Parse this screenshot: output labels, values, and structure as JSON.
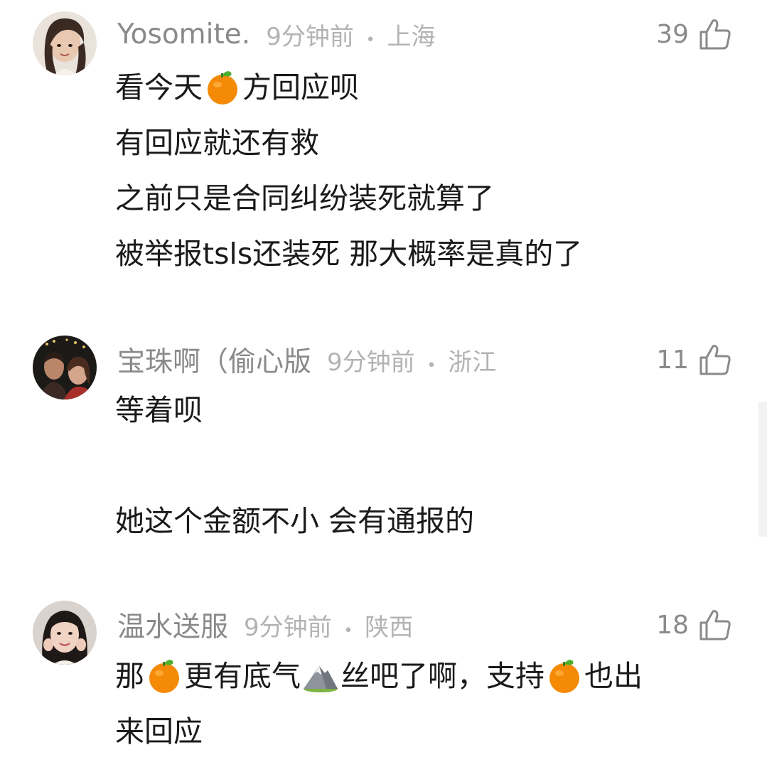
{
  "comments": [
    {
      "username": "Yosomite.",
      "time": "9分钟前",
      "location": "上海",
      "likes": "39",
      "lines": [
        [
          "看今天",
          {
            "emoji": "orange-emoji"
          },
          "方回应呗"
        ],
        [
          "有回应就还有救"
        ],
        [
          "之前只是合同纠纷装死就算了"
        ],
        [
          "被举报tsls还装死 那大概率是真的了"
        ]
      ]
    },
    {
      "username": "宝珠啊（偷心版",
      "time": "9分钟前",
      "location": "浙江",
      "likes": "11",
      "lines": [
        [
          "等着呗"
        ],
        [
          ""
        ],
        [
          "她这个金额不小 会有通报的"
        ]
      ]
    },
    {
      "username": "温水送服",
      "time": "9分钟前",
      "location": "陕西",
      "likes": "18",
      "lines": [
        [
          "那",
          {
            "emoji": "orange-emoji"
          },
          "更有底气",
          {
            "emoji": "mountain-emoji"
          },
          "丝吧了啊，支持",
          {
            "emoji": "orange-emoji"
          },
          "也出"
        ],
        [
          "来回应"
        ]
      ]
    }
  ],
  "meta_separator": "•",
  "icons": {
    "like": "thumbs-up-icon",
    "orange": "orange-emoji",
    "mountain": "mountain-emoji"
  },
  "colors": {
    "username": "#8a8a8a",
    "meta": "#b3b3b3",
    "text": "#1a1a1a",
    "orange": "#f58a07"
  }
}
